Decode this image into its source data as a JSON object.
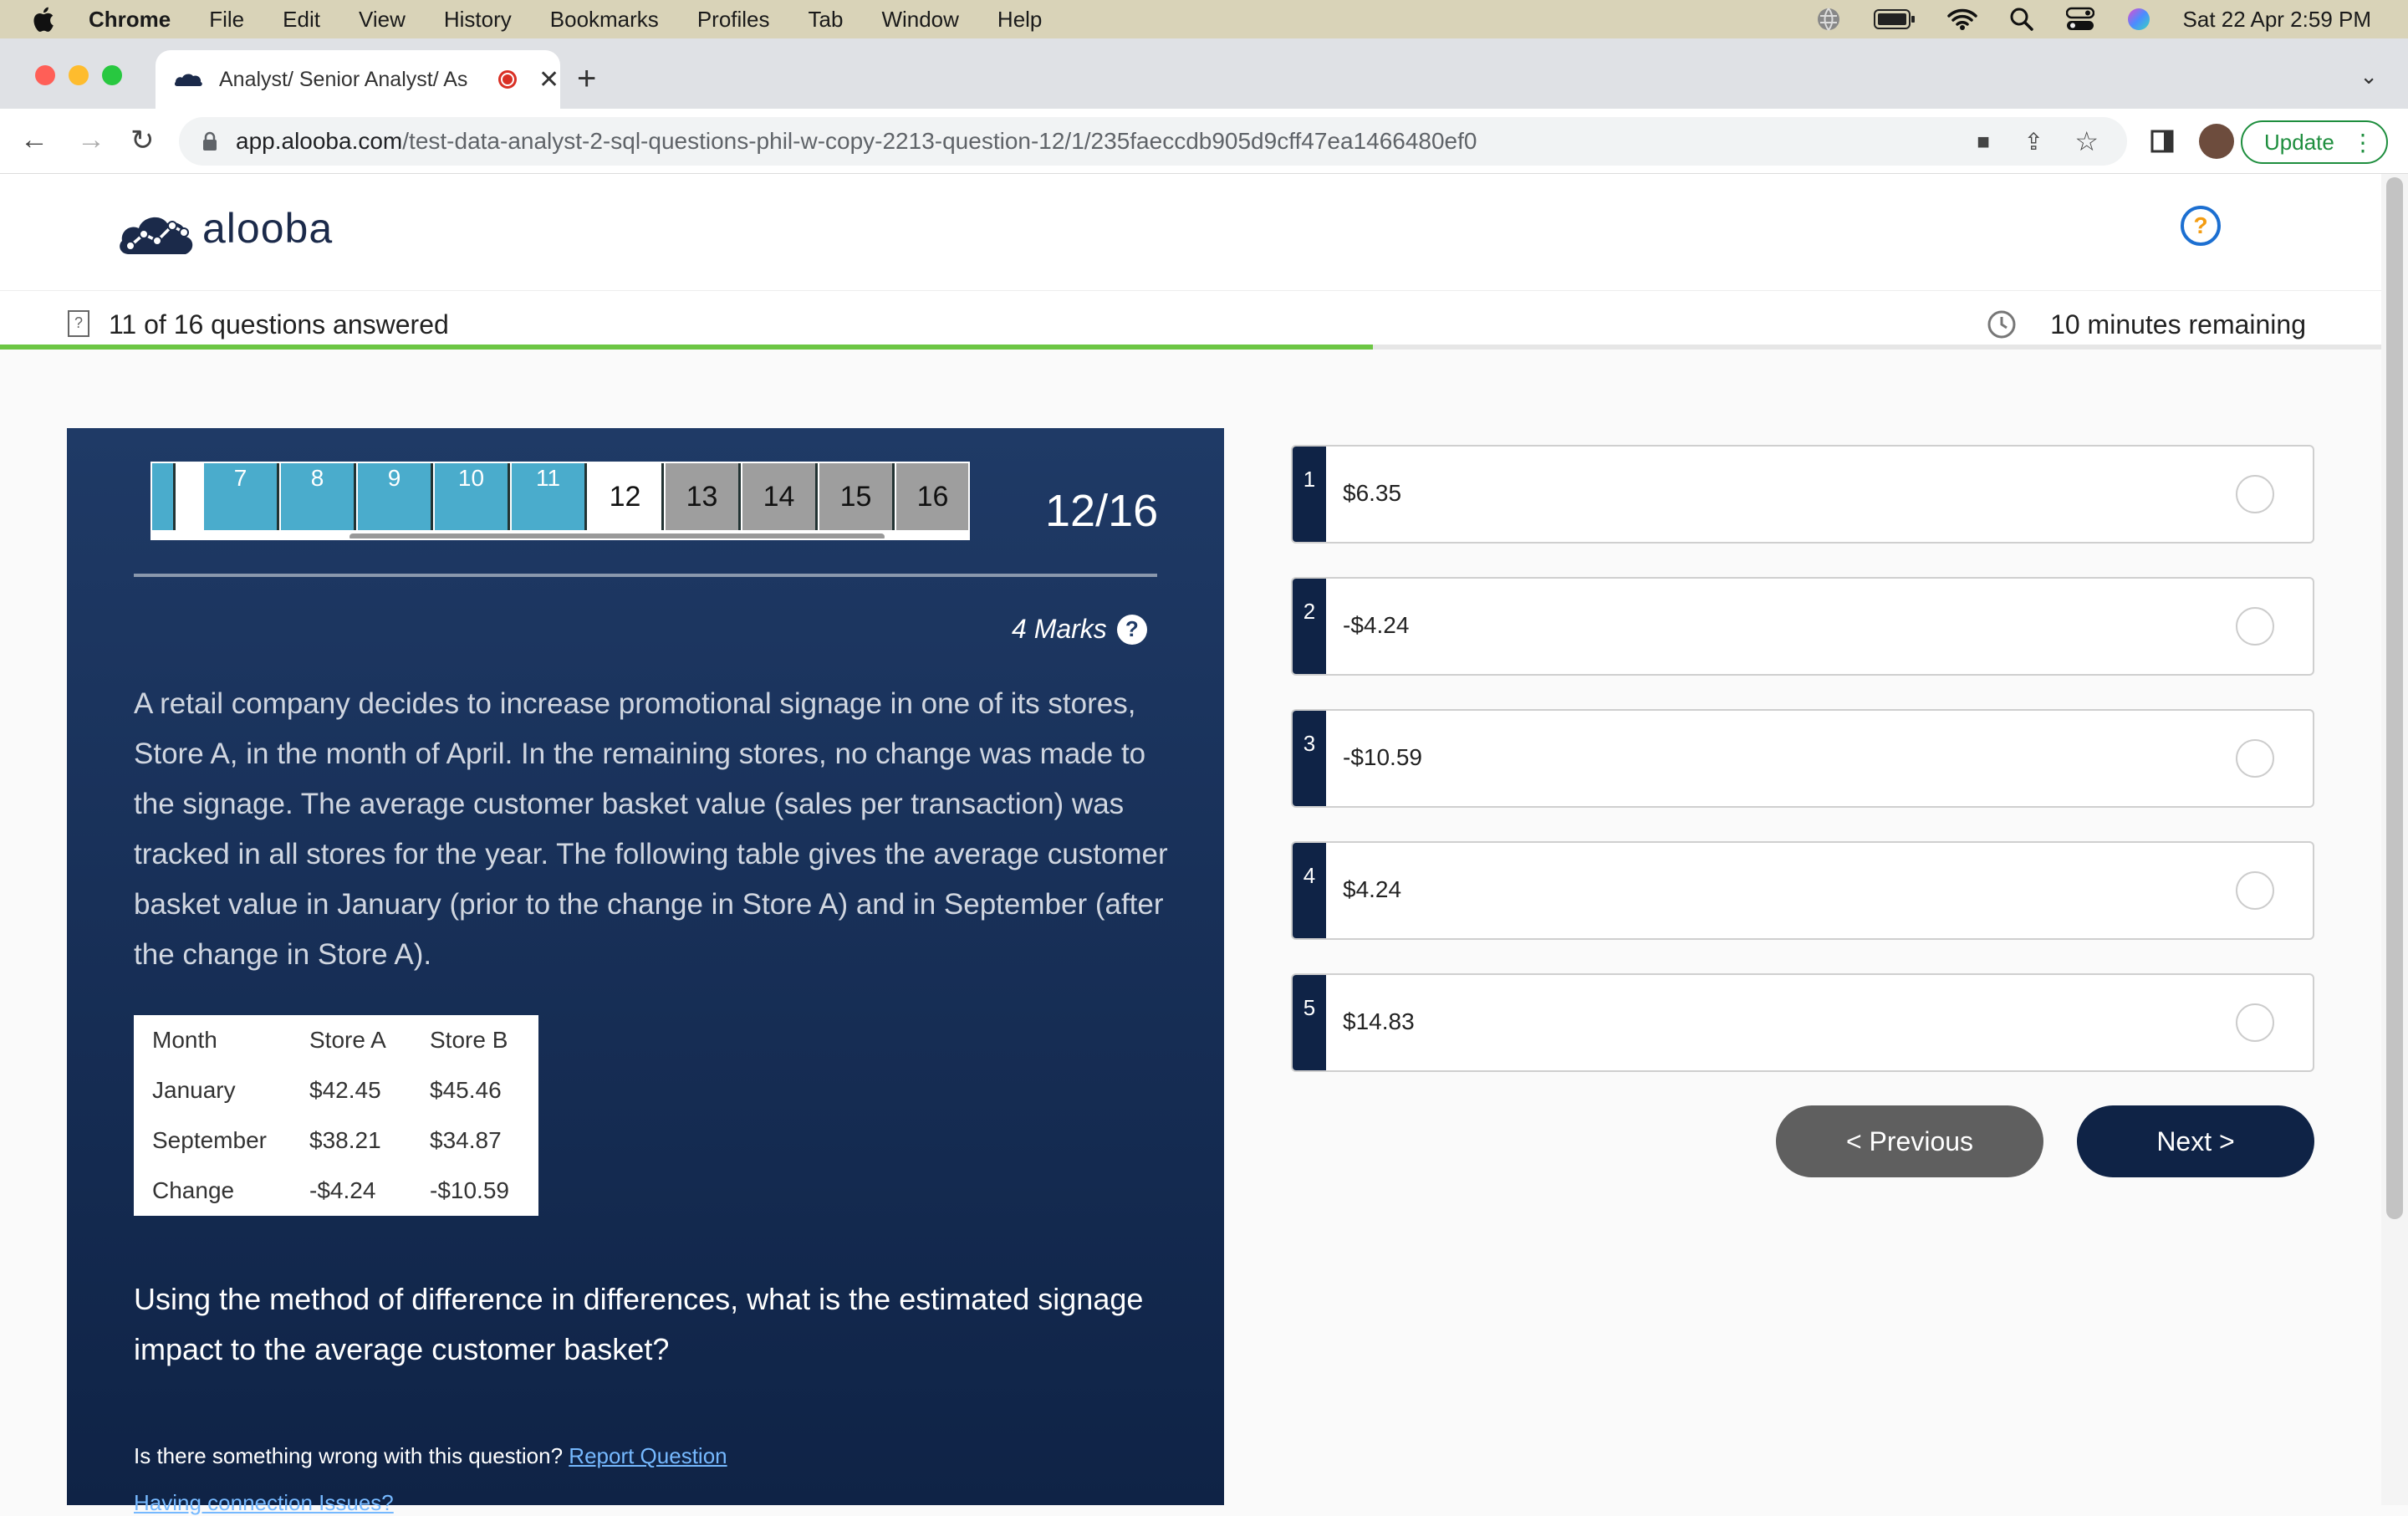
{
  "menubar": {
    "app": "Chrome",
    "items": [
      "File",
      "Edit",
      "View",
      "History",
      "Bookmarks",
      "Profiles",
      "Tab",
      "Window",
      "Help"
    ],
    "datetime": "Sat 22 Apr  2:59 PM"
  },
  "browser": {
    "tab_title": "Analyst/ Senior Analyst/ As",
    "url_host": "app.alooba.com",
    "url_path": "/test-data-analyst-2-sql-questions-phil-w-copy-2213-question-12/1/235faeccdb905d9cff47ea1466480ef0",
    "update_label": "Update"
  },
  "brand": {
    "name": "alooba"
  },
  "progress": {
    "answered_text": "11 of 16 questions answered",
    "remaining_text": "10 minutes remaining",
    "fraction": 0.57
  },
  "question": {
    "nav": [
      {
        "label": "",
        "state": "answered"
      },
      {
        "label": "7",
        "state": "answered"
      },
      {
        "label": "8",
        "state": "answered"
      },
      {
        "label": "9",
        "state": "answered"
      },
      {
        "label": "10",
        "state": "answered"
      },
      {
        "label": "11",
        "state": "answered"
      },
      {
        "label": "12",
        "state": "current"
      },
      {
        "label": "13",
        "state": "unanswered"
      },
      {
        "label": "14",
        "state": "unanswered"
      },
      {
        "label": "15",
        "state": "unanswered"
      },
      {
        "label": "16",
        "state": "unanswered"
      }
    ],
    "counter": "12/16",
    "marks": "4 Marks",
    "prompt": "A retail company decides to increase promotional signage in one of its stores, Store A, in the month of April. In the remaining stores, no change was made to the signage. The average customer basket value (sales per transaction) was tracked in all stores for the year. The following table gives the average customer basket value in January (prior to the change in Store A) and in September (after the change in Store A).",
    "table": {
      "headers": [
        "Month",
        "Store A",
        "Store B"
      ],
      "rows": [
        [
          "January",
          "$42.45",
          "$45.46"
        ],
        [
          "September",
          "$38.21",
          "$34.87"
        ],
        [
          "Change",
          "-$4.24",
          "-$10.59"
        ]
      ]
    },
    "ask": "Using the method of difference in differences, what is the estimated signage impact to the average customer basket?",
    "report_prefix": "Is there something wrong with this question?",
    "report_link": "Report Question",
    "connection_link": "Having connection Issues?"
  },
  "options": [
    {
      "num": "1",
      "value": "$6.35"
    },
    {
      "num": "2",
      "value": "-$4.24"
    },
    {
      "num": "3",
      "value": "-$10.59"
    },
    {
      "num": "4",
      "value": "$4.24"
    },
    {
      "num": "5",
      "value": "$14.83"
    }
  ],
  "buttons": {
    "previous": "< Previous",
    "next": "Next >"
  },
  "colors": {
    "panel": "#1f3a66",
    "accent_dark": "#0f2346",
    "answered": "#4aaccc",
    "progress": "#6cc644"
  }
}
